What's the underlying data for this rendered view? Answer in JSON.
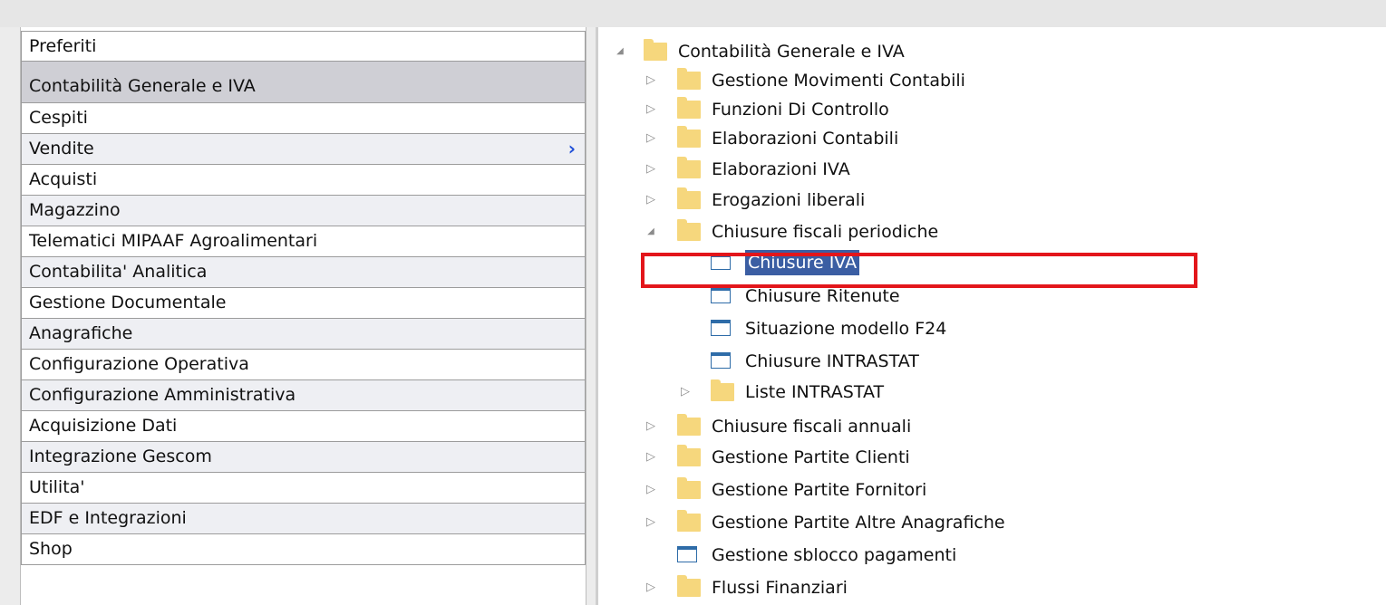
{
  "left_menu": {
    "items": [
      {
        "label": "Preferiti",
        "style": "plain"
      },
      {
        "label": "Contabilità Generale e IVA",
        "style": "selected"
      },
      {
        "label": "Cespiti",
        "style": "plain"
      },
      {
        "label": "Vendite",
        "style": "alt",
        "has_submenu": true
      },
      {
        "label": "Acquisti",
        "style": "plain"
      },
      {
        "label": "Magazzino",
        "style": "alt"
      },
      {
        "label": "Telematici MIPAAF Agroalimentari",
        "style": "plain"
      },
      {
        "label": "Contabilita' Analitica",
        "style": "alt"
      },
      {
        "label": "Gestione Documentale",
        "style": "plain"
      },
      {
        "label": "Anagrafiche",
        "style": "alt"
      },
      {
        "label": "Configurazione Operativa",
        "style": "plain"
      },
      {
        "label": "Configurazione Amministrativa",
        "style": "alt"
      },
      {
        "label": "Acquisizione Dati",
        "style": "plain"
      },
      {
        "label": "Integrazione Gescom",
        "style": "alt"
      },
      {
        "label": "Utilita'",
        "style": "plain"
      },
      {
        "label": "EDF e Integrazioni",
        "style": "alt"
      },
      {
        "label": "Shop",
        "style": "plain"
      }
    ],
    "submenu_icon": "chevron-right-icon",
    "submenu_color": "#1f4fd8"
  },
  "tree": {
    "nodes": [
      {
        "label": "Contabilità Generale e IVA",
        "type": "folder",
        "level": 0,
        "expanded": true
      },
      {
        "label": "Gestione Movimenti Contabili",
        "type": "folder",
        "level": 1,
        "expanded": false
      },
      {
        "label": "Funzioni Di Controllo",
        "type": "folder",
        "level": 1,
        "expanded": false
      },
      {
        "label": "Elaborazioni Contabili",
        "type": "folder",
        "level": 1,
        "expanded": false
      },
      {
        "label": "Elaborazioni IVA",
        "type": "folder",
        "level": 1,
        "expanded": false
      },
      {
        "label": "Erogazioni liberali",
        "type": "folder",
        "level": 1,
        "expanded": false
      },
      {
        "label": "Chiusure fiscali periodiche",
        "type": "folder",
        "level": 1,
        "expanded": true
      },
      {
        "label": "Chiusure IVA",
        "type": "item",
        "level": 2,
        "selected": true
      },
      {
        "label": "Chiusure Ritenute",
        "type": "item",
        "level": 2
      },
      {
        "label": "Situazione modello F24",
        "type": "item",
        "level": 2
      },
      {
        "label": "Chiusure INTRASTAT",
        "type": "item",
        "level": 2
      },
      {
        "label": "Liste INTRASTAT",
        "type": "folder",
        "level": 2,
        "expanded": false
      },
      {
        "label": "Chiusure fiscali annuali",
        "type": "folder",
        "level": 1,
        "expanded": false
      },
      {
        "label": "Gestione Partite Clienti",
        "type": "folder",
        "level": 1,
        "expanded": false
      },
      {
        "label": "Gestione Partite Fornitori",
        "type": "folder",
        "level": 1,
        "expanded": false
      },
      {
        "label": "Gestione Partite Altre Anagrafiche",
        "type": "folder",
        "level": 1,
        "expanded": false
      },
      {
        "label": "Gestione sblocco pagamenti",
        "type": "item",
        "level": 1
      },
      {
        "label": "Flussi Finanziari",
        "type": "folder",
        "level": 1,
        "expanded": false
      }
    ],
    "glyphs": {
      "expanded": "◢",
      "collapsed": "▷"
    },
    "folder_icon": "folder-icon",
    "item_icon": "window-icon",
    "folder_color": "#f6d77d",
    "selection_color": "#3b5ea3",
    "highlight_color": "#e3161b"
  }
}
